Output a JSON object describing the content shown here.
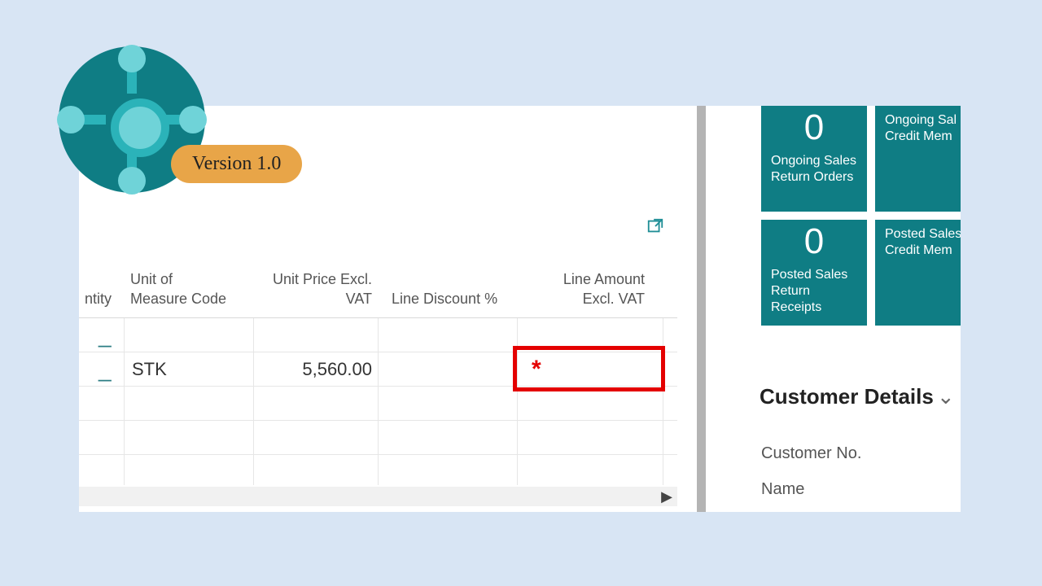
{
  "badge": {
    "version_label": "Version 1.0"
  },
  "grid": {
    "columns": {
      "quantity": "ntity",
      "uom": "Unit of\nMeasure Code",
      "unit_price": "Unit Price Excl.\nVAT",
      "line_discount": "Line Discount %",
      "line_amount": "Line Amount\nExcl. VAT"
    },
    "rows": [
      {
        "qty_marker": "_",
        "uom": "",
        "unit_price": "",
        "line_discount": "",
        "line_amount": ""
      },
      {
        "qty_marker": "_",
        "uom": "STK",
        "unit_price": "5,560.00",
        "line_discount": "",
        "line_amount": "*"
      },
      {
        "qty_marker": "",
        "uom": "",
        "unit_price": "",
        "line_discount": "",
        "line_amount": ""
      },
      {
        "qty_marker": "",
        "uom": "",
        "unit_price": "",
        "line_discount": "",
        "line_amount": ""
      },
      {
        "qty_marker": "",
        "uom": "",
        "unit_price": "",
        "line_discount": "",
        "line_amount": ""
      }
    ]
  },
  "tiles": {
    "return_orders": {
      "value": "0",
      "label": "Ongoing Sales\nReturn Orders"
    },
    "credit_memos": {
      "value": "",
      "label": "Ongoing Sal\nCredit Mem"
    },
    "return_receipts": {
      "value": "0",
      "label": "Posted Sales\nReturn Receipts"
    },
    "posted_memos": {
      "value": "",
      "label": "Posted Sales\nCredit Mem"
    }
  },
  "details": {
    "header": "Customer Details",
    "fields": {
      "customer_no": "Customer No.",
      "name": "Name"
    }
  }
}
